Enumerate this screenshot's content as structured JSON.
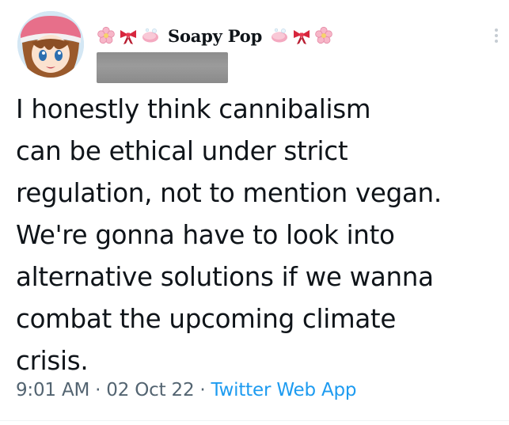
{
  "author": {
    "display_name": "Soapy Pop",
    "name_decorations_left": [
      "cherry-blossom",
      "ribbon",
      "soap"
    ],
    "name_decorations_right": [
      "soap",
      "ribbon",
      "cherry-blossom"
    ],
    "handle_redacted": true
  },
  "tweet": {
    "lines": [
      "I honestly think cannibalism",
      "can be ethical under strict",
      "regulation, not to mention vegan.",
      "We're gonna have to look into",
      "alternative solutions if we wanna",
      "combat the upcoming climate",
      "crisis."
    ]
  },
  "meta": {
    "time": "9:01 AM",
    "separator": "·",
    "date": "02 Oct 22",
    "source": "Twitter Web App"
  },
  "colors": {
    "text": "#0f1419",
    "meta_text": "#536471",
    "link": "#1d9bf0"
  }
}
